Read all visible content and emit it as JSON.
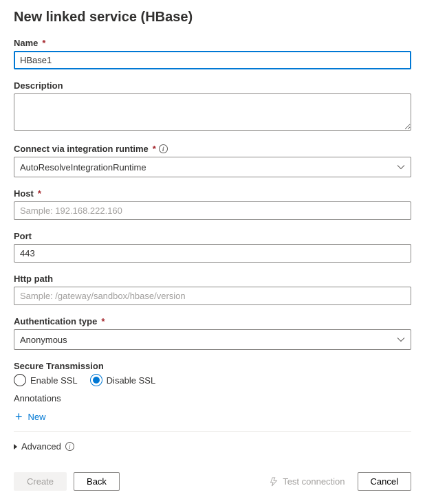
{
  "title": "New linked service (HBase)",
  "name": {
    "label": "Name",
    "value": "HBase1"
  },
  "description": {
    "label": "Description",
    "value": ""
  },
  "runtime": {
    "label": "Connect via integration runtime",
    "value": "AutoResolveIntegrationRuntime"
  },
  "host": {
    "label": "Host",
    "value": "",
    "placeholder": "Sample: 192.168.222.160"
  },
  "port": {
    "label": "Port",
    "value": "443"
  },
  "httpPath": {
    "label": "Http path",
    "value": "",
    "placeholder": "Sample: /gateway/sandbox/hbase/version"
  },
  "authType": {
    "label": "Authentication type",
    "value": "Anonymous"
  },
  "secureTransmission": {
    "label": "Secure Transmission",
    "enable": "Enable SSL",
    "disable": "Disable SSL"
  },
  "annotations": {
    "label": "Annotations",
    "newLabel": "New"
  },
  "advanced": {
    "label": "Advanced"
  },
  "footer": {
    "create": "Create",
    "back": "Back",
    "test": "Test connection",
    "cancel": "Cancel"
  }
}
